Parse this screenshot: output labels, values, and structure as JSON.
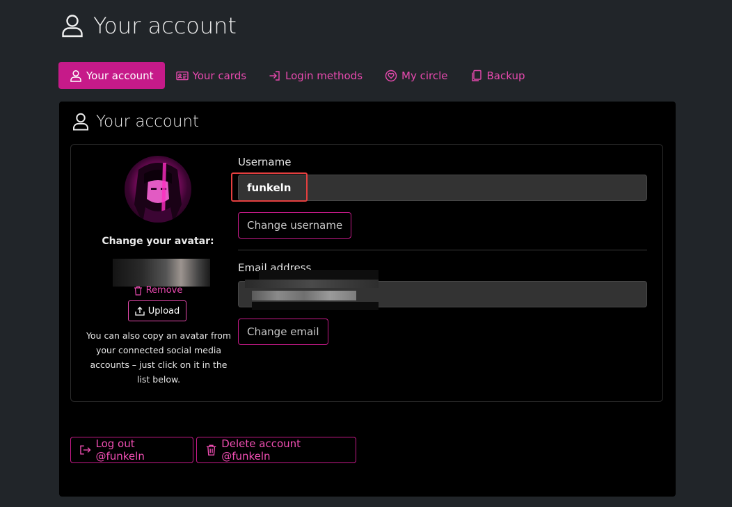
{
  "page": {
    "title": "Your account"
  },
  "tabs": [
    {
      "label": "Your account",
      "icon": "person-icon",
      "active": true
    },
    {
      "label": "Your cards",
      "icon": "id-card-icon",
      "active": false
    },
    {
      "label": "Login methods",
      "icon": "login-icon",
      "active": false
    },
    {
      "label": "My circle",
      "icon": "heart-circle-icon",
      "active": false
    },
    {
      "label": "Backup",
      "icon": "copy-icon",
      "active": false
    }
  ],
  "panel": {
    "title": "Your account",
    "avatar": {
      "heading": "Change your avatar:",
      "remove_label": "Remove",
      "upload_label": "Upload",
      "help_text": "You can also copy an avatar from your connected social media accounts – just click on it in the list below."
    },
    "username": {
      "label": "Username",
      "value": "funkeln",
      "change_label": "Change username"
    },
    "email": {
      "label": "Email address",
      "value": "",
      "change_label": "Change email"
    }
  },
  "actions": {
    "logout_label": "Log out @funkeln",
    "delete_label": "Delete account @funkeln"
  },
  "colors": {
    "accent": "#c61a89",
    "accent_text": "#e84aaf",
    "highlight": "#e53f3f",
    "background": "#212529"
  }
}
